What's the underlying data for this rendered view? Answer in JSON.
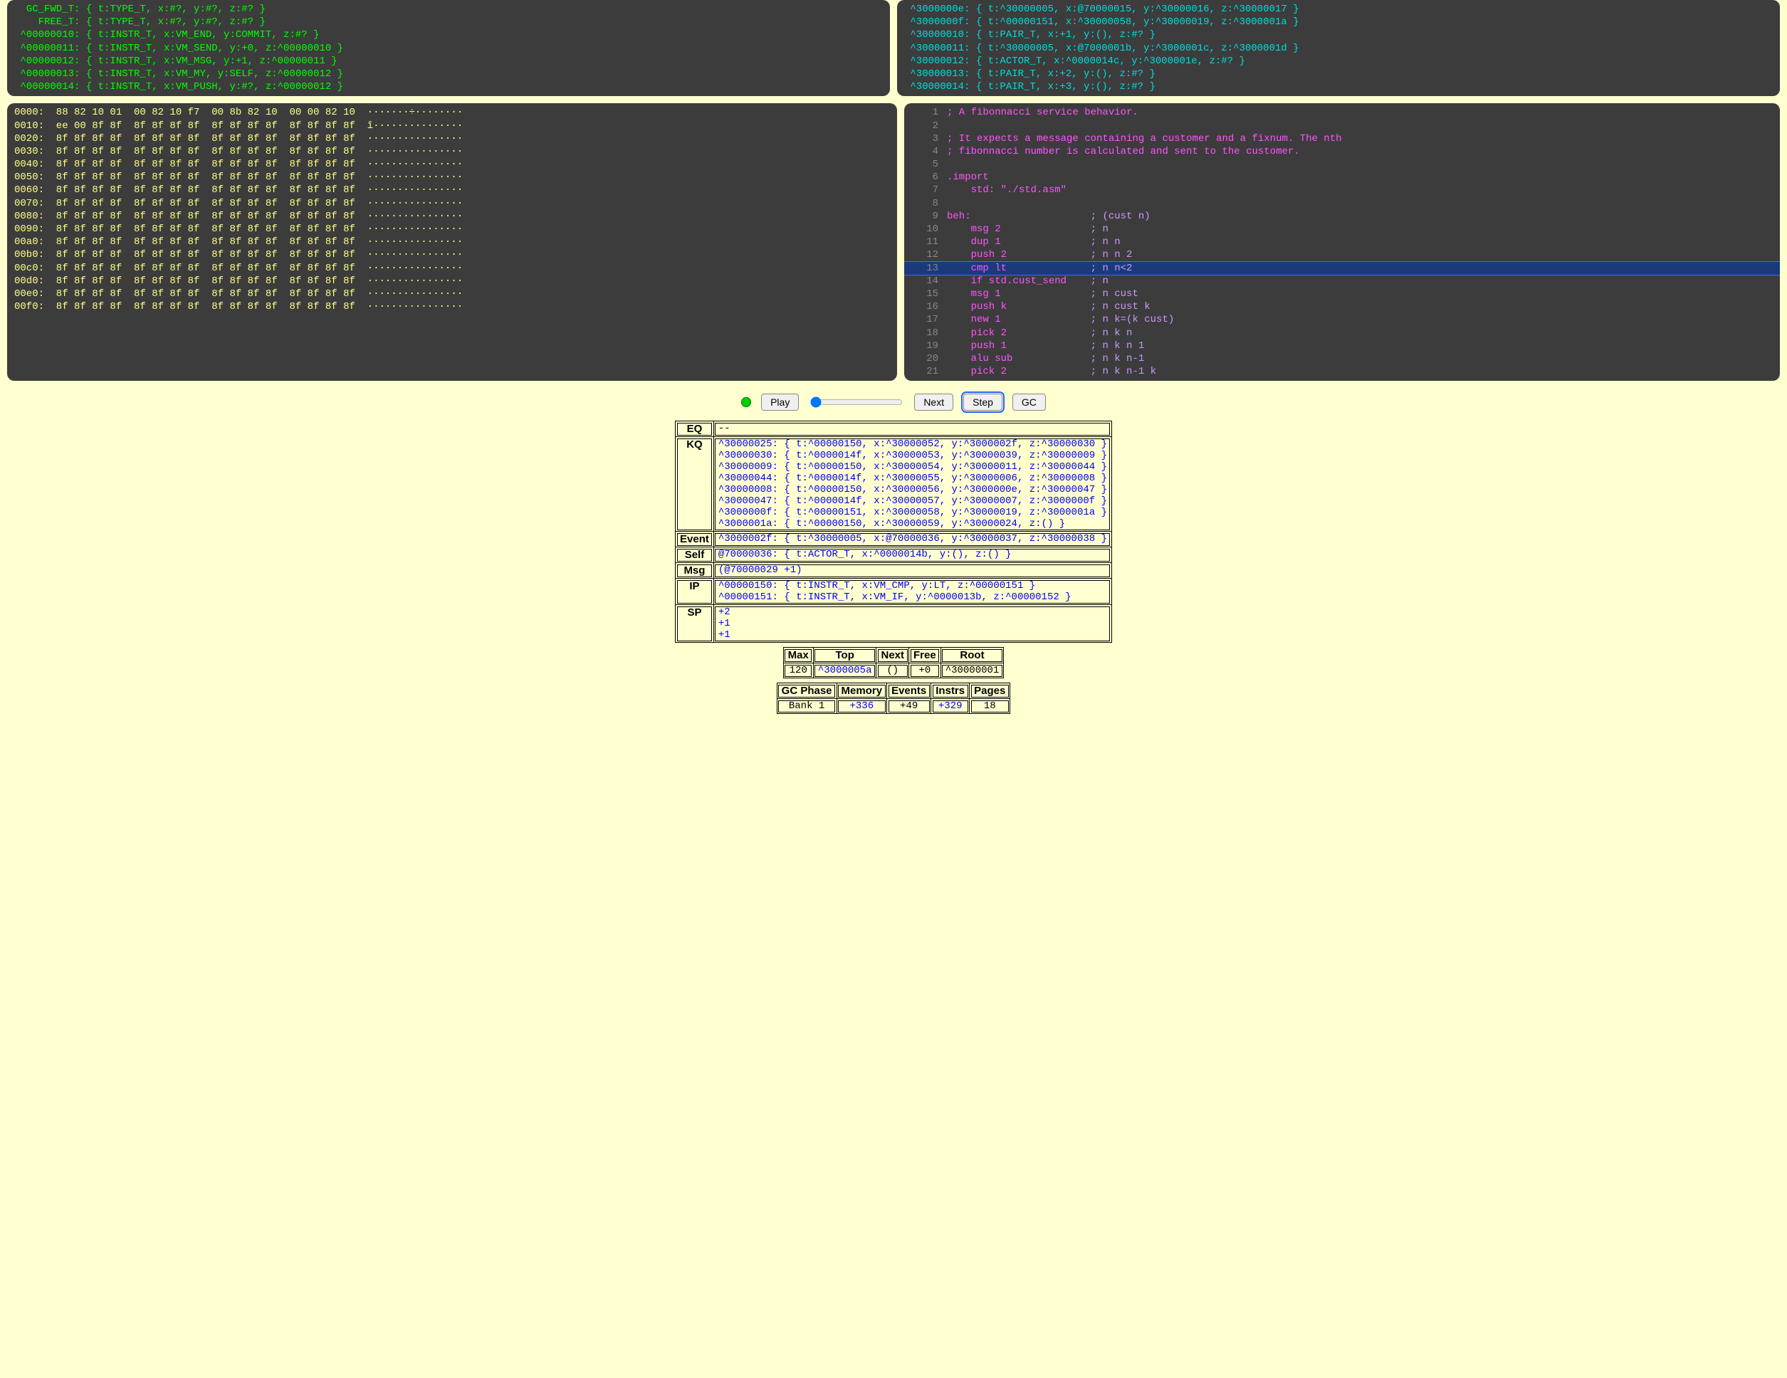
{
  "topLeft": [
    "  GC_FWD_T: { t:TYPE_T, x:#?, y:#?, z:#? }",
    "    FREE_T: { t:TYPE_T, x:#?, y:#?, z:#? }",
    " ^00000010: { t:INSTR_T, x:VM_END, y:COMMIT, z:#? }",
    " ^00000011: { t:INSTR_T, x:VM_SEND, y:+0, z:^00000010 }",
    " ^00000012: { t:INSTR_T, x:VM_MSG, y:+1, z:^00000011 }",
    " ^00000013: { t:INSTR_T, x:VM_MY, y:SELF, z:^00000012 }",
    " ^00000014: { t:INSTR_T, x:VM_PUSH, y:#?, z:^00000012 }"
  ],
  "topRight": [
    " ^3000000e: { t:^30000005, x:@70000015, y:^30000016, z:^30000017 }",
    " ^3000000f: { t:^00000151, x:^30000058, y:^30000019, z:^3000001a }",
    " ^30000010: { t:PAIR_T, x:+1, y:(), z:#? }",
    " ^30000011: { t:^30000005, x:@7000001b, y:^3000001c, z:^3000001d }",
    " ^30000012: { t:ACTOR_T, x:^0000014c, y:^3000001e, z:#? }",
    " ^30000013: { t:PAIR_T, x:+2, y:(), z:#? }",
    " ^30000014: { t:PAIR_T, x:+3, y:(), z:#? }"
  ],
  "hex": [
    "0000:  88 82 10 01  00 82 10 f7  00 8b 82 10  00 00 82 10  ·······÷········",
    "0010:  ee 00 8f 8f  8f 8f 8f 8f  8f 8f 8f 8f  8f 8f 8f 8f  î···············",
    "0020:  8f 8f 8f 8f  8f 8f 8f 8f  8f 8f 8f 8f  8f 8f 8f 8f  ················",
    "0030:  8f 8f 8f 8f  8f 8f 8f 8f  8f 8f 8f 8f  8f 8f 8f 8f  ················",
    "0040:  8f 8f 8f 8f  8f 8f 8f 8f  8f 8f 8f 8f  8f 8f 8f 8f  ················",
    "0050:  8f 8f 8f 8f  8f 8f 8f 8f  8f 8f 8f 8f  8f 8f 8f 8f  ················",
    "0060:  8f 8f 8f 8f  8f 8f 8f 8f  8f 8f 8f 8f  8f 8f 8f 8f  ················",
    "0070:  8f 8f 8f 8f  8f 8f 8f 8f  8f 8f 8f 8f  8f 8f 8f 8f  ················",
    "0080:  8f 8f 8f 8f  8f 8f 8f 8f  8f 8f 8f 8f  8f 8f 8f 8f  ················",
    "0090:  8f 8f 8f 8f  8f 8f 8f 8f  8f 8f 8f 8f  8f 8f 8f 8f  ················",
    "00a0:  8f 8f 8f 8f  8f 8f 8f 8f  8f 8f 8f 8f  8f 8f 8f 8f  ················",
    "00b0:  8f 8f 8f 8f  8f 8f 8f 8f  8f 8f 8f 8f  8f 8f 8f 8f  ················",
    "00c0:  8f 8f 8f 8f  8f 8f 8f 8f  8f 8f 8f 8f  8f 8f 8f 8f  ················",
    "00d0:  8f 8f 8f 8f  8f 8f 8f 8f  8f 8f 8f 8f  8f 8f 8f 8f  ················",
    "00e0:  8f 8f 8f 8f  8f 8f 8f 8f  8f 8f 8f 8f  8f 8f 8f 8f  ················",
    "00f0:  8f 8f 8f 8f  8f 8f 8f 8f  8f 8f 8f 8f  8f 8f 8f 8f  ················"
  ],
  "source": {
    "current": 13,
    "lines": [
      {
        "n": 1,
        "code": "; A fibonnacci service behavior.",
        "comment": ""
      },
      {
        "n": 2,
        "code": "",
        "comment": ""
      },
      {
        "n": 3,
        "code": "; It expects a message containing a customer and a fixnum. The nth",
        "comment": ""
      },
      {
        "n": 4,
        "code": "; fibonnacci number is calculated and sent to the customer.",
        "comment": ""
      },
      {
        "n": 5,
        "code": "",
        "comment": ""
      },
      {
        "n": 6,
        "code": ".import",
        "comment": ""
      },
      {
        "n": 7,
        "code": "    std: \"./std.asm\"",
        "comment": ""
      },
      {
        "n": 8,
        "code": "",
        "comment": ""
      },
      {
        "n": 9,
        "code": "beh:                    ",
        "comment": "; (cust n)"
      },
      {
        "n": 10,
        "code": "    msg 2               ",
        "comment": "; n"
      },
      {
        "n": 11,
        "code": "    dup 1               ",
        "comment": "; n n"
      },
      {
        "n": 12,
        "code": "    push 2              ",
        "comment": "; n n 2"
      },
      {
        "n": 13,
        "code": "    cmp lt              ",
        "comment": "; n n<2"
      },
      {
        "n": 14,
        "code": "    if std.cust_send    ",
        "comment": "; n"
      },
      {
        "n": 15,
        "code": "    msg 1               ",
        "comment": "; n cust"
      },
      {
        "n": 16,
        "code": "    push k              ",
        "comment": "; n cust k"
      },
      {
        "n": 17,
        "code": "    new 1               ",
        "comment": "; n k=(k cust)"
      },
      {
        "n": 18,
        "code": "    pick 2              ",
        "comment": "; n k n"
      },
      {
        "n": 19,
        "code": "    push 1              ",
        "comment": "; n k n 1"
      },
      {
        "n": 20,
        "code": "    alu sub             ",
        "comment": "; n k n-1"
      },
      {
        "n": 21,
        "code": "    pick 2              ",
        "comment": "; n k n-1 k"
      }
    ]
  },
  "controls": {
    "play": "Play",
    "next": "Next",
    "step": "Step",
    "gc": "GC",
    "slider": 0
  },
  "state": {
    "EQ": "--",
    "KQ": [
      "^30000025: { t:^00000150, x:^30000052, y:^3000002f, z:^30000030 }",
      "^30000030: { t:^0000014f, x:^30000053, y:^30000039, z:^30000009 }",
      "^30000009: { t:^00000150, x:^30000054, y:^30000011, z:^30000044 }",
      "^30000044: { t:^0000014f, x:^30000055, y:^30000006, z:^30000008 }",
      "^30000008: { t:^00000150, x:^30000056, y:^3000000e, z:^30000047 }",
      "^30000047: { t:^0000014f, x:^30000057, y:^30000007, z:^3000000f }",
      "^3000000f: { t:^00000151, x:^30000058, y:^30000019, z:^3000001a }",
      "^3000001a: { t:^00000150, x:^30000059, y:^30000024, z:() }"
    ],
    "Event": "^3000002f: { t:^30000005, x:@70000036, y:^30000037, z:^30000038 }",
    "Self": "@70000036: { t:ACTOR_T, x:^0000014b, y:(), z:() }",
    "Msg": "(@70000029 +1)",
    "IP": [
      "^00000150: { t:INSTR_T, x:VM_CMP, y:LT, z:^00000151 }",
      "^00000151: { t:INSTR_T, x:VM_IF, y:^0000013b, z:^00000152 }"
    ],
    "SP": [
      "+2",
      "+1",
      "+1"
    ]
  },
  "mem": {
    "headers": [
      "Max",
      "Top",
      "Next",
      "Free",
      "Root"
    ],
    "row": {
      "Max": "120",
      "Top": "^3000005a",
      "Next": "()",
      "Free": "+0",
      "Root": "^30000001"
    }
  },
  "gc": {
    "headers": [
      "GC Phase",
      "Memory",
      "Events",
      "Instrs",
      "Pages"
    ],
    "row": {
      "GCPhase": "Bank 1",
      "Memory": "+336",
      "Events": "+49",
      "Instrs": "+329",
      "Pages": "18"
    }
  }
}
